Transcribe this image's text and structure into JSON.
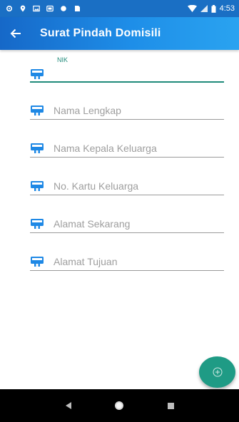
{
  "status_bar": {
    "time": "4:53",
    "icons": [
      "settings-icon",
      "location-icon",
      "image-icon",
      "gallery-icon",
      "circle-icon",
      "sd-card-icon",
      "wifi-icon",
      "signal-icon",
      "battery-icon"
    ]
  },
  "app_bar": {
    "title": "Surat Pindah Domisili",
    "back_icon": "arrow-left-icon"
  },
  "form": {
    "fields": [
      {
        "label": "NIK",
        "value": "",
        "active": true
      },
      {
        "placeholder": "Nama Lengkap"
      },
      {
        "placeholder": "Nama Kepala Keluarga"
      },
      {
        "placeholder": "No. Kartu Keluarga"
      },
      {
        "placeholder": "Alamat Sekarang"
      },
      {
        "placeholder": "Alamat Tujuan"
      }
    ],
    "field_icon": "credit-card-icon"
  },
  "fab": {
    "icon": "add-circle-icon"
  },
  "nav_bar": {
    "icons": [
      "back-triangle-icon",
      "home-circle-icon",
      "recents-square-icon"
    ]
  },
  "colors": {
    "app_bar": "#1e8ee8",
    "accent": "#1f8a7a",
    "field_icon": "#1e88e5",
    "fab": "#1f9b85"
  }
}
